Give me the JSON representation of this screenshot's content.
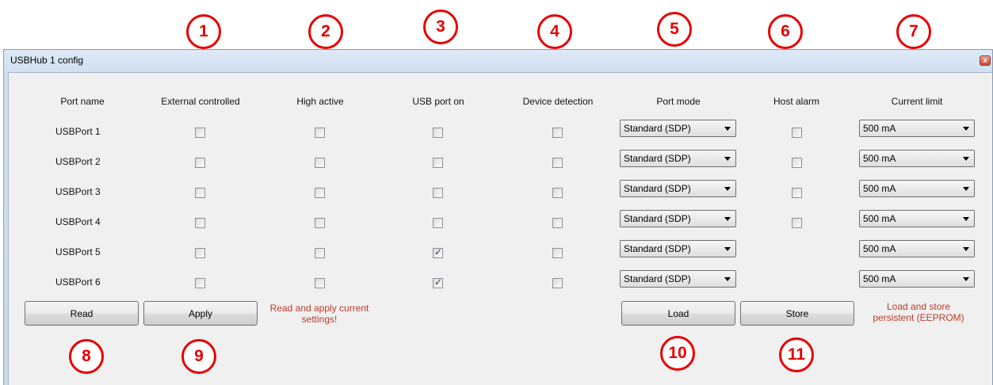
{
  "window": {
    "title": "USBHub 1 config",
    "close_glyph": "x"
  },
  "callouts": [
    "1",
    "2",
    "3",
    "4",
    "5",
    "6",
    "7",
    "8",
    "9",
    "10",
    "11"
  ],
  "columns": {
    "port_name": "Port name",
    "external_controlled": "External controlled",
    "high_active": "High active",
    "usb_port_on": "USB port on",
    "device_detection": "Device detection",
    "port_mode": "Port mode",
    "host_alarm": "Host alarm",
    "current_limit": "Current limit"
  },
  "ports": [
    {
      "name": "USBPort 1",
      "external": false,
      "high_active": false,
      "usb_on": false,
      "device_detection": false,
      "port_mode": "Standard (SDP)",
      "host_alarm": false,
      "current_limit": "500 mA"
    },
    {
      "name": "USBPort 2",
      "external": false,
      "high_active": false,
      "usb_on": false,
      "device_detection": false,
      "port_mode": "Standard (SDP)",
      "host_alarm": false,
      "current_limit": "500 mA"
    },
    {
      "name": "USBPort 3",
      "external": false,
      "high_active": false,
      "usb_on": false,
      "device_detection": false,
      "port_mode": "Standard (SDP)",
      "host_alarm": false,
      "current_limit": "500 mA"
    },
    {
      "name": "USBPort 4",
      "external": false,
      "high_active": false,
      "usb_on": false,
      "device_detection": false,
      "port_mode": "Standard (SDP)",
      "host_alarm": false,
      "current_limit": "500 mA"
    },
    {
      "name": "USBPort 5",
      "external": false,
      "high_active": false,
      "usb_on": true,
      "device_detection": false,
      "port_mode": "Standard (SDP)",
      "current_limit": "500 mA"
    },
    {
      "name": "USBPort 6",
      "external": false,
      "high_active": false,
      "usb_on": true,
      "device_detection": false,
      "port_mode": "Standard (SDP)",
      "current_limit": "500 mA"
    }
  ],
  "buttons": {
    "read": "Read",
    "apply": "Apply",
    "load": "Load",
    "store": "Store"
  },
  "notes": {
    "read_apply_line1": "Read and apply current",
    "read_apply_line2": "settings!",
    "load_store_line1": "Load and store",
    "load_store_line2": "persistent (EEPROM)"
  },
  "colors": {
    "callout": "#e60000",
    "note": "#c0392b"
  }
}
